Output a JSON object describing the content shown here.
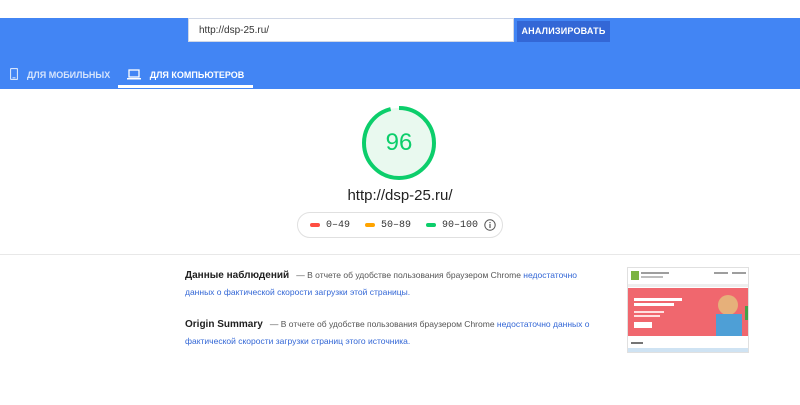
{
  "search": {
    "value": "http://dsp-25.ru/",
    "button_label": "АНАЛИЗИРОВАТЬ"
  },
  "tabs": [
    {
      "label": "ДЛЯ МОБИЛЬНЫХ",
      "icon": "smartphone-icon",
      "active": false
    },
    {
      "label": "ДЛЯ КОМПЬЮТЕРОВ",
      "icon": "laptop-icon",
      "active": true
    }
  ],
  "score": {
    "value": "96",
    "fraction": 0.96,
    "color": "#0cce6b"
  },
  "site_url": "http://dsp-25.ru/",
  "legend": [
    {
      "label": "0–49",
      "color": "#ff4e42"
    },
    {
      "label": "50–89",
      "color": "#ffa400"
    },
    {
      "label": "90–100",
      "color": "#0cce6b"
    }
  ],
  "sections": [
    {
      "title": "Данные наблюдений",
      "text": "— В отчете об удобстве пользования браузером Chrome",
      "link": "недостаточно данных о фактической скорости загрузки этой страницы."
    },
    {
      "title": "Origin Summary",
      "text": "— В отчете об удобстве пользования браузером Chrome",
      "link": "недостаточно данных о фактической скорости загрузки страниц этого источника."
    }
  ],
  "colors": {
    "header": "#4285f4",
    "button": "#3367d6",
    "link": "#3367d6"
  }
}
